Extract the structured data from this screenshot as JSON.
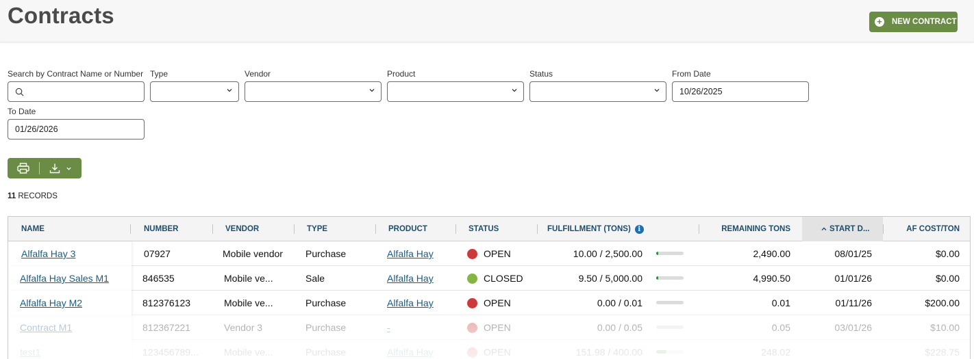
{
  "header": {
    "title": "Contracts",
    "new_contract_label": "NEW CONTRACT"
  },
  "filters": {
    "search": {
      "label": "Search by Contract Name or Number",
      "value": ""
    },
    "type": {
      "label": "Type",
      "value": ""
    },
    "vendor": {
      "label": "Vendor",
      "value": ""
    },
    "product": {
      "label": "Product",
      "value": ""
    },
    "status": {
      "label": "Status",
      "value": ""
    },
    "from_date": {
      "label": "From Date",
      "value": "10/26/2025"
    },
    "to_date": {
      "label": "To Date",
      "value": "01/26/2026"
    }
  },
  "toolbar": {
    "print_icon": "printer-icon",
    "download_icon": "download-icon"
  },
  "records": {
    "count": "11",
    "label": "RECORDS"
  },
  "table": {
    "columns": {
      "name": "NAME",
      "number": "NUMBER",
      "vendor": "VENDOR",
      "type": "TYPE",
      "product": "PRODUCT",
      "status": "STATUS",
      "fulfillment": "FULFILLMENT (TONS)",
      "remaining": "REMAINING TONS",
      "start_date": "START D...",
      "af_cost": "AF COST/TON"
    },
    "rows": [
      {
        "name": "Alfalfa Hay 3",
        "number": "07927",
        "vendor": "Mobile vendor",
        "type": "Purchase",
        "product": "Alfalfa Hay",
        "status": "OPEN",
        "status_color": "#cc3b3b",
        "fulfillment": "10.00 / 2,500.00",
        "fulfillment_pct": 0.004,
        "remaining": "2,490.00",
        "start_date": "08/01/25",
        "af_cost": "$0.00"
      },
      {
        "name": "Alfalfa Hay Sales M1",
        "number": "846535",
        "vendor": "Mobile ve...",
        "type": "Sale",
        "product": "Alfalfa Hay",
        "status": "CLOSED",
        "status_color": "#86b543",
        "fulfillment": "9.50 / 5,000.00",
        "fulfillment_pct": 0.002,
        "remaining": "4,990.50",
        "start_date": "01/01/26",
        "af_cost": "$0.00"
      },
      {
        "name": "Alfalfa Hay M2",
        "number": "812376123",
        "vendor": "Mobile ve...",
        "type": "Purchase",
        "product": "Alfalfa Hay",
        "status": "OPEN",
        "status_color": "#cc3b3b",
        "fulfillment": "0.00 / 0.01",
        "fulfillment_pct": 0,
        "remaining": "0.01",
        "start_date": "01/11/26",
        "af_cost": "$200.00"
      },
      {
        "name": "Contract M1",
        "number": "812367221",
        "vendor": "Vendor 3",
        "type": "Purchase",
        "product": "-",
        "status": "OPEN",
        "status_color": "#cc3b3b",
        "fulfillment": "0.00 / 0.05",
        "fulfillment_pct": 0,
        "remaining": "0.05",
        "start_date": "03/01/26",
        "af_cost": "$10.00"
      },
      {
        "name": "test1",
        "number": "123456789...",
        "vendor": "Mobile ve...",
        "type": "Purchase",
        "product": "Alfalfa Hay",
        "status": "OPEN",
        "status_color": "#cc3b3b",
        "fulfillment": "151.98 / 400.00",
        "fulfillment_pct": 0.38,
        "remaining": "248.02",
        "start_date": "",
        "af_cost": "$228.75"
      }
    ]
  }
}
